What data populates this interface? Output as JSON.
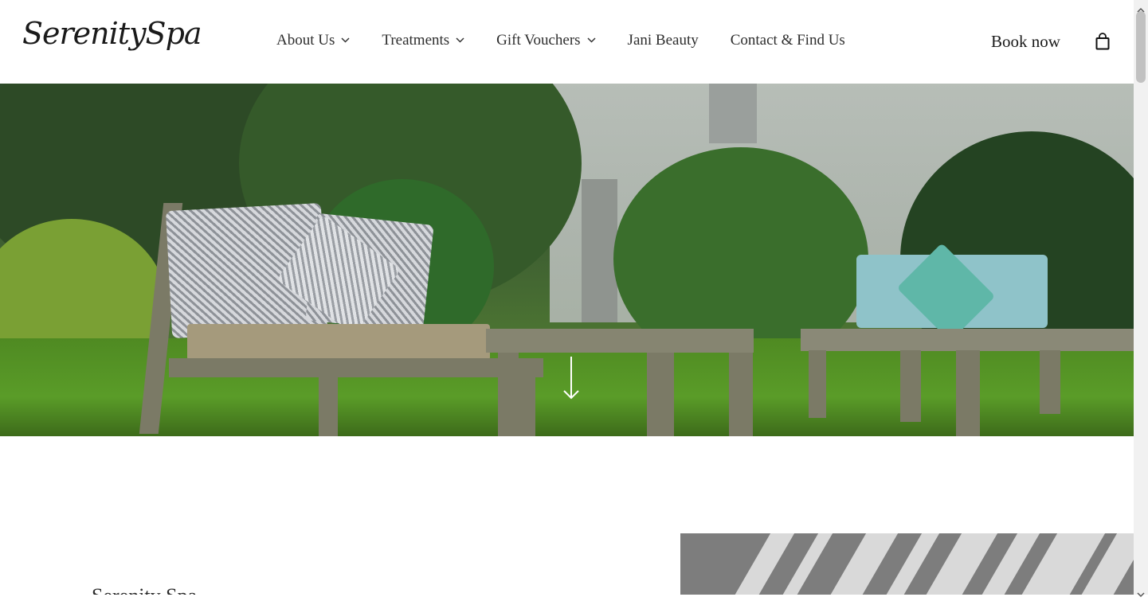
{
  "brand": {
    "logo_text": "SerenitySpa"
  },
  "nav": {
    "items": [
      {
        "label": "About Us",
        "has_dropdown": true
      },
      {
        "label": "Treatments",
        "has_dropdown": true
      },
      {
        "label": "Gift Vouchers",
        "has_dropdown": true
      },
      {
        "label": "Jani Beauty",
        "has_dropdown": false
      },
      {
        "label": "Contact & Find Us",
        "has_dropdown": false
      }
    ],
    "book_now_label": "Book now",
    "cart_icon": "shopping-bag-icon"
  },
  "hero": {
    "scroll_icon": "arrow-down-icon",
    "image_description_icon": "garden-photo"
  },
  "lower": {
    "heading_partial": "Serenity Spa"
  },
  "colors": {
    "text": "#2b2b2b",
    "background": "#ffffff",
    "grass": "#5a9c28"
  }
}
